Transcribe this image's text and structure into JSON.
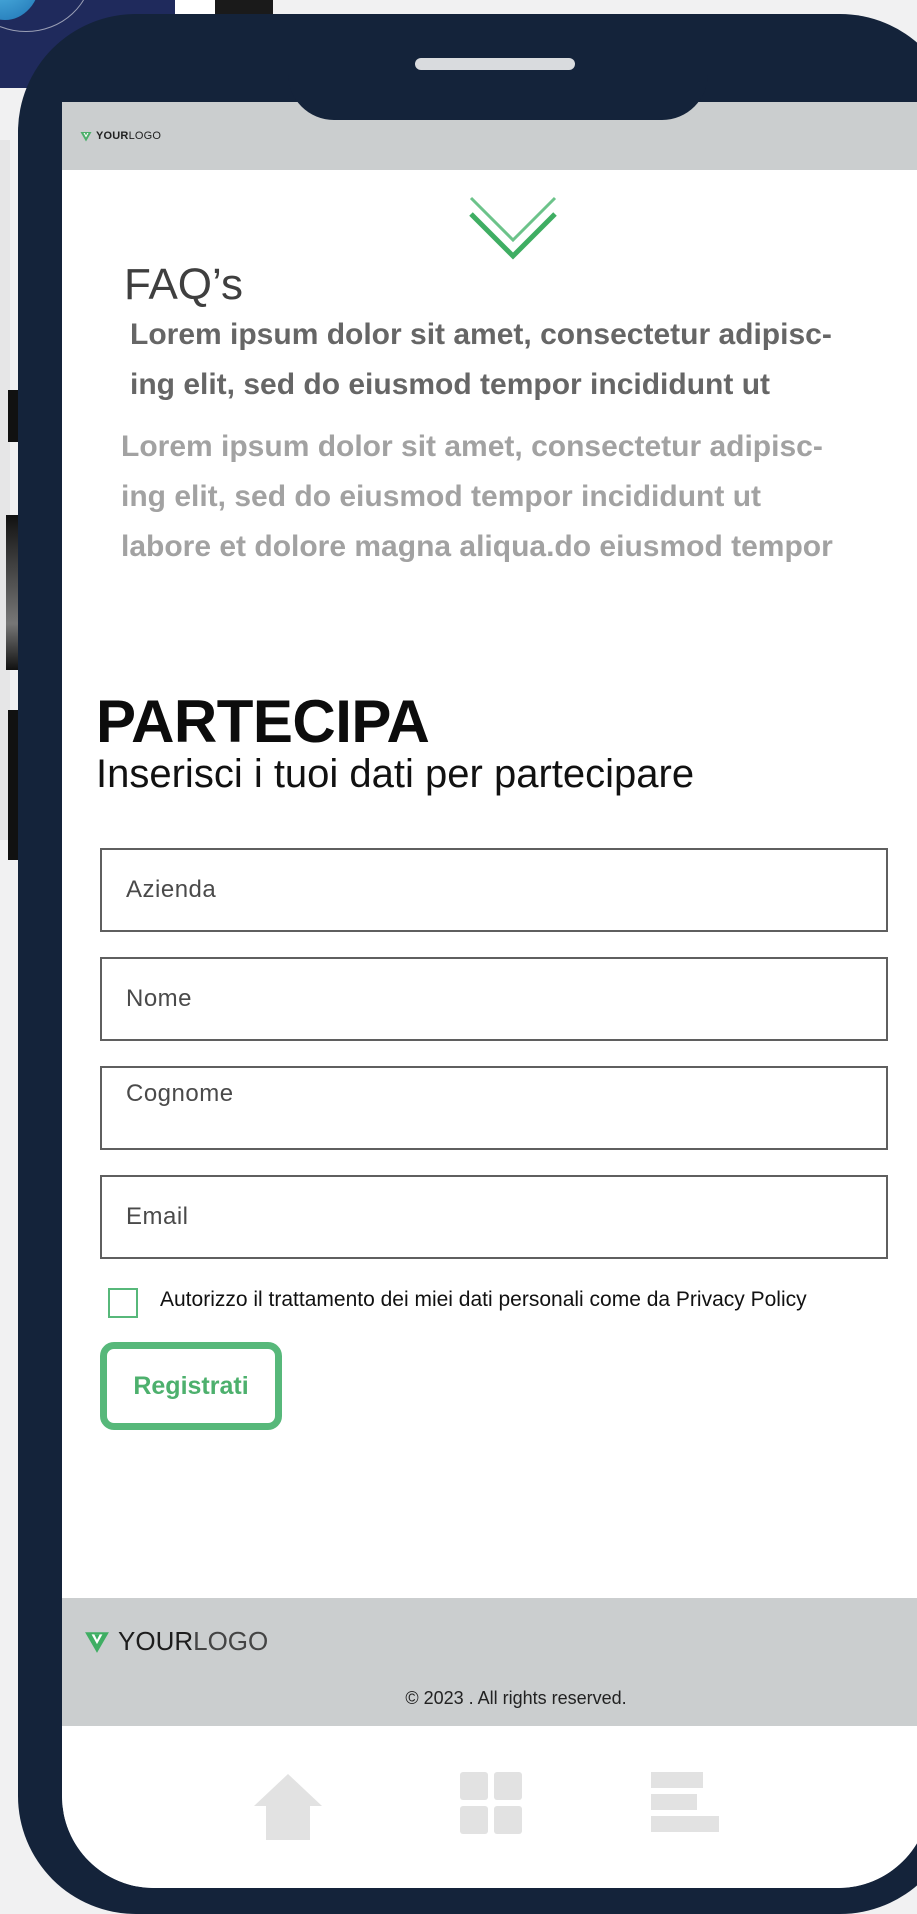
{
  "colors": {
    "brand_green": "#57b87a",
    "phone_frame": "#14233a",
    "header_gray": "#cbcecf",
    "nav_icon_gray": "#e2e2e2"
  },
  "header": {
    "logo_bold": "YOUR",
    "logo_light": "LOGO",
    "logo_icon": "v-leaf-icon"
  },
  "faq": {
    "chevron_icon": "chevron-double-down-icon",
    "title": "FAQ’s",
    "question_line1": "Lorem ipsum dolor sit amet, consectetur adipisc-",
    "question_line2": "ing elit, sed do eiusmod tempor incididunt ut",
    "answer_line1": "Lorem ipsum dolor sit amet, consectetur adipisc-",
    "answer_line2": "ing elit, sed do eiusmod tempor incididunt ut",
    "answer_line3": "labore et dolore magna aliqua.do eiusmod tempor"
  },
  "form": {
    "title": "PARTECIPA",
    "subtitle": "Inserisci i tuoi dati per partecipare",
    "company_placeholder": "Azienda",
    "first_name_placeholder": "Nome",
    "last_name_placeholder": "Cognome",
    "email_placeholder": "Email",
    "consent_label": "Autorizzo il trattamento dei miei dati personali come da Privacy Policy",
    "consent_checked": false,
    "submit_label": "Registrati"
  },
  "footer": {
    "logo_bold": "YOUR",
    "logo_light": "LOGO",
    "copyright": "© 2023 . All rights reserved."
  },
  "bottom_nav": {
    "items": [
      "home-icon",
      "grid-icon",
      "menu-bars-icon"
    ]
  }
}
